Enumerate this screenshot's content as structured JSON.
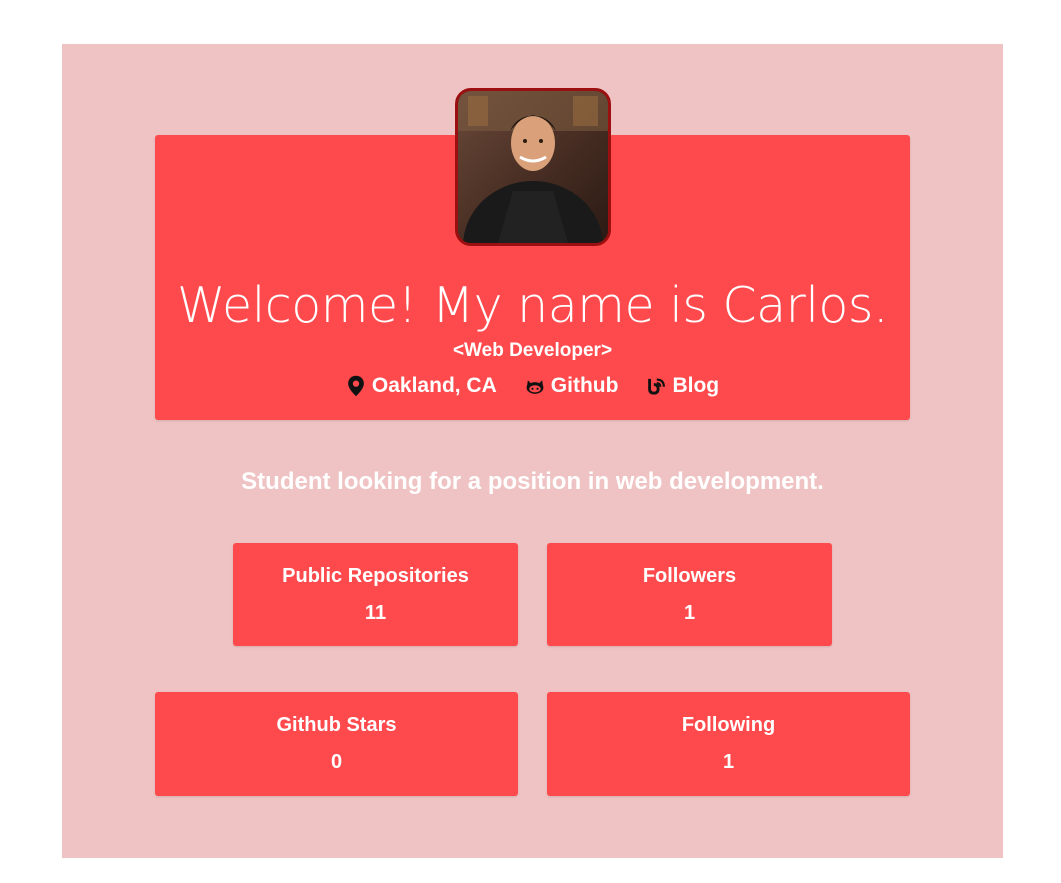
{
  "profile": {
    "avatar_alt": "Profile photo of Carlos",
    "welcome": "Welcome! My name is Carlos.",
    "role": "<Web Developer>",
    "tagline": "Student looking for a position in web development."
  },
  "links": {
    "location": {
      "label": "Oakland, CA",
      "icon": "map-marker-icon"
    },
    "github": {
      "label": "Github",
      "icon": "github-octocat-icon"
    },
    "blog": {
      "label": "Blog",
      "icon": "blog-rss-icon"
    }
  },
  "stats": [
    {
      "label": "Public Repositories",
      "value": "11"
    },
    {
      "label": "Followers",
      "value": "1"
    },
    {
      "label": "Github Stars",
      "value": "0"
    },
    {
      "label": "Following",
      "value": "1"
    }
  ],
  "colors": {
    "panel": "#efc3c3",
    "card": "#ff4a4d",
    "avatar_border": "#9c0f10",
    "text": "#ffffff"
  }
}
